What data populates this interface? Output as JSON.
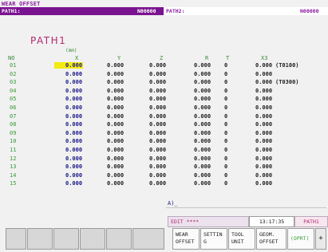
{
  "screen_title": "WEAR OFFSET",
  "path1_bar": {
    "label": "PATH1:",
    "value": "N00000"
  },
  "path2_bar": {
    "label": "PATH2:",
    "value": "N00000"
  },
  "path_heading": "PATH1",
  "unit_label": "(mm)",
  "columns": [
    "NO",
    "X",
    "Y",
    "Z",
    "R",
    "T",
    "X3"
  ],
  "rows": [
    {
      "no": "01",
      "x": "0.000",
      "y": "0.000",
      "z": "0.000",
      "r": "0.000",
      "t": "0",
      "x3": "0.000",
      "note": "(T0100)"
    },
    {
      "no": "02",
      "x": "0.000",
      "y": "0.000",
      "z": "0.000",
      "r": "0.000",
      "t": "0",
      "x3": "0.000",
      "note": ""
    },
    {
      "no": "03",
      "x": "0.000",
      "y": "0.000",
      "z": "0.000",
      "r": "0.000",
      "t": "0",
      "x3": "0.000",
      "note": "(T0300)"
    },
    {
      "no": "04",
      "x": "0.000",
      "y": "0.000",
      "z": "0.000",
      "r": "0.000",
      "t": "0",
      "x3": "0.000",
      "note": ""
    },
    {
      "no": "05",
      "x": "0.000",
      "y": "0.000",
      "z": "0.000",
      "r": "0.000",
      "t": "0",
      "x3": "0.000",
      "note": ""
    },
    {
      "no": "06",
      "x": "0.000",
      "y": "0.000",
      "z": "0.000",
      "r": "0.000",
      "t": "0",
      "x3": "0.000",
      "note": ""
    },
    {
      "no": "07",
      "x": "0.000",
      "y": "0.000",
      "z": "0.000",
      "r": "0.000",
      "t": "0",
      "x3": "0.000",
      "note": ""
    },
    {
      "no": "08",
      "x": "0.000",
      "y": "0.000",
      "z": "0.000",
      "r": "0.000",
      "t": "0",
      "x3": "0.000",
      "note": ""
    },
    {
      "no": "09",
      "x": "0.000",
      "y": "0.000",
      "z": "0.000",
      "r": "0.000",
      "t": "0",
      "x3": "0.000",
      "note": ""
    },
    {
      "no": "10",
      "x": "0.000",
      "y": "0.000",
      "z": "0.000",
      "r": "0.000",
      "t": "0",
      "x3": "0.000",
      "note": ""
    },
    {
      "no": "11",
      "x": "0.000",
      "y": "0.000",
      "z": "0.000",
      "r": "0.000",
      "t": "0",
      "x3": "0.000",
      "note": ""
    },
    {
      "no": "12",
      "x": "0.000",
      "y": "0.000",
      "z": "0.000",
      "r": "0.000",
      "t": "0",
      "x3": "0.000",
      "note": ""
    },
    {
      "no": "13",
      "x": "0.000",
      "y": "0.000",
      "z": "0.000",
      "r": "0.000",
      "t": "0",
      "x3": "0.000",
      "note": ""
    },
    {
      "no": "14",
      "x": "0.000",
      "y": "0.000",
      "z": "0.000",
      "r": "0.000",
      "t": "0",
      "x3": "0.000",
      "note": ""
    },
    {
      "no": "15",
      "x": "0.000",
      "y": "0.000",
      "z": "0.000",
      "r": "0.000",
      "t": "0",
      "x3": "0.000",
      "note": ""
    }
  ],
  "input_line": "A)_",
  "status": {
    "mode": "EDIT ****",
    "time": "13:17:35",
    "path": "PATH1"
  },
  "softkeys": [
    {
      "line1": "WEAR",
      "line2": "OFFSET"
    },
    {
      "line1": "SETTIN",
      "line2": "G"
    },
    {
      "line1": "TOOL",
      "line2": "UNIT"
    },
    {
      "line1": "GEOM.",
      "line2": "OFFSET"
    },
    {
      "line1": "(OPRT)",
      "line2": ""
    },
    {
      "line1": "+",
      "line2": ""
    }
  ]
}
